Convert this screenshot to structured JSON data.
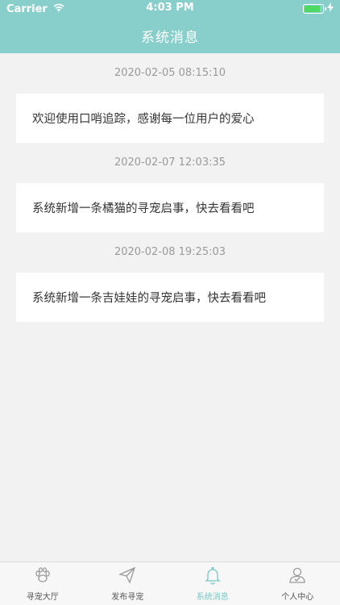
{
  "status_bar": {
    "carrier": "Carrier",
    "time": "4:03 PM"
  },
  "header": {
    "title": "系统消息"
  },
  "messages": [
    {
      "time": "2020-02-05 08:15:10",
      "text": "欢迎使用口哨追踪，感谢每一位用户的爱心"
    },
    {
      "time": "2020-02-07 12:03:35",
      "text": "系统新增一条橘猫的寻宠启事，快去看看吧"
    },
    {
      "time": "2020-02-08 19:25:03",
      "text": "系统新增一条吉娃娃的寻宠启事，快去看看吧"
    }
  ],
  "tabbar": {
    "tabs": [
      {
        "label": "寻宠大厅",
        "icon": "paw-icon"
      },
      {
        "label": "发布寻宠",
        "icon": "paper-plane-icon"
      },
      {
        "label": "系统消息",
        "icon": "bell-icon",
        "active": true
      },
      {
        "label": "个人中心",
        "icon": "person-icon"
      }
    ]
  },
  "colors": {
    "header": "#88cfcb",
    "active_tab": "#7ac8c4",
    "battery": "#4cd964"
  }
}
